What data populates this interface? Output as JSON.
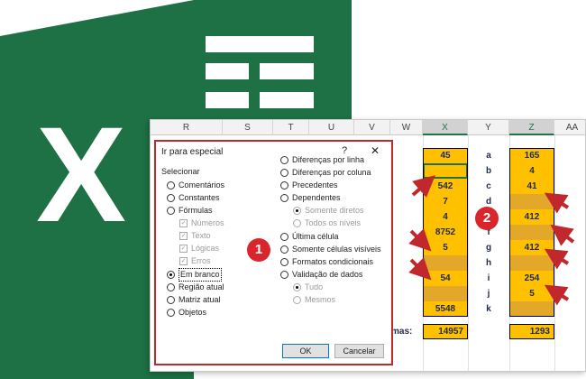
{
  "colors": {
    "excel_green": "#217346",
    "accent_yellow": "#ffc000",
    "badge_red": "#d9262c",
    "arrow_red": "#c0282d"
  },
  "logo": {
    "letter": "X",
    "icon": "excel-logo-icon"
  },
  "sheet": {
    "columns": [
      "R",
      "S",
      "T",
      "U",
      "V",
      "W",
      "X",
      "Y",
      "Z",
      "AA"
    ],
    "col_x_values": [
      "45",
      "",
      "542",
      "7",
      "4",
      "8752",
      "5",
      "",
      "54",
      "",
      "5548"
    ],
    "col_y_values": [
      "a",
      "b",
      "c",
      "d",
      "e",
      "f",
      "g",
      "h",
      "i",
      "j",
      "k"
    ],
    "col_z_values": [
      "165",
      "4",
      "41",
      "",
      "412",
      "",
      "412",
      "",
      "254",
      "5",
      ""
    ],
    "sum_label": "mas:",
    "sum_x": "14957",
    "sum_z": "1293"
  },
  "dialog": {
    "title": "Ir para especial",
    "help": "?",
    "close": "✕",
    "section": "Selecionar",
    "left_options": [
      {
        "label": "Comentários",
        "checked": false,
        "enabled": true
      },
      {
        "label": "Constantes",
        "checked": false,
        "enabled": true
      },
      {
        "label": "Fórmulas",
        "checked": false,
        "enabled": true
      },
      {
        "label": "Números",
        "checkbox": true,
        "enabled": false
      },
      {
        "label": "Texto",
        "checkbox": true,
        "enabled": false
      },
      {
        "label": "Lógicas",
        "checkbox": true,
        "enabled": false
      },
      {
        "label": "Erros",
        "checkbox": true,
        "enabled": false
      },
      {
        "label": "Em branco",
        "checked": true,
        "enabled": true
      },
      {
        "label": "Região atual",
        "checked": false,
        "enabled": true
      },
      {
        "label": "Matriz atual",
        "checked": false,
        "enabled": true
      },
      {
        "label": "Objetos",
        "checked": false,
        "enabled": true
      }
    ],
    "right_options": [
      {
        "label": "Diferenças por linha",
        "checked": false,
        "enabled": true
      },
      {
        "label": "Diferenças por coluna",
        "checked": false,
        "enabled": true
      },
      {
        "label": "Precedentes",
        "checked": false,
        "enabled": true
      },
      {
        "label": "Dependentes",
        "checked": false,
        "enabled": true
      },
      {
        "label": "Somente diretos",
        "checked": true,
        "enabled": false
      },
      {
        "label": "Todos os níveis",
        "checked": false,
        "enabled": false
      },
      {
        "label": "Última célula",
        "checked": false,
        "enabled": true
      },
      {
        "label": "Somente células visíveis",
        "checked": false,
        "enabled": true
      },
      {
        "label": "Formatos condicionais",
        "checked": false,
        "enabled": true
      },
      {
        "label": "Validação de dados",
        "checked": false,
        "enabled": true
      },
      {
        "label": "Tudo",
        "checked": true,
        "enabled": false
      },
      {
        "label": "Mesmos",
        "checked": false,
        "enabled": false
      }
    ],
    "ok_label": "OK",
    "cancel_label": "Cancelar"
  },
  "badges": {
    "one": "1",
    "two": "2"
  }
}
